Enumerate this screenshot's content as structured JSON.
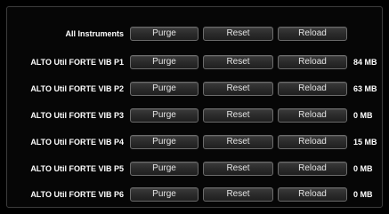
{
  "all_row": {
    "label": "All Instruments",
    "purge": "Purge",
    "reset": "Reset",
    "reload": "Reload"
  },
  "instruments": [
    {
      "label": "ALTO Util FORTE VIB P1",
      "purge": "Purge",
      "reset": "Reset",
      "reload": "Reload",
      "size": "84 MB"
    },
    {
      "label": "ALTO Util FORTE VIB P2",
      "purge": "Purge",
      "reset": "Reset",
      "reload": "Reload",
      "size": "63 MB"
    },
    {
      "label": "ALTO Util FORTE VIB P3",
      "purge": "Purge",
      "reset": "Reset",
      "reload": "Reload",
      "size": "0 MB"
    },
    {
      "label": "ALTO Util FORTE VIB P4",
      "purge": "Purge",
      "reset": "Reset",
      "reload": "Reload",
      "size": "15 MB"
    },
    {
      "label": "ALTO Util FORTE VIB P5",
      "purge": "Purge",
      "reset": "Reset",
      "reload": "Reload",
      "size": "0 MB"
    },
    {
      "label": "ALTO Util FORTE VIB P6",
      "purge": "Purge",
      "reset": "Reset",
      "reload": "Reload",
      "size": "0 MB"
    }
  ]
}
